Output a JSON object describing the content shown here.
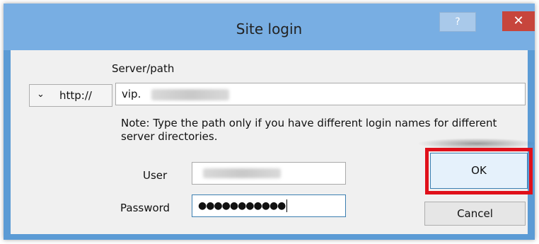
{
  "window": {
    "title": "Site login",
    "help_symbol": "?",
    "close_symbol": "✕"
  },
  "form": {
    "protocol_selected": "http://",
    "protocol_icon": "chevron-down-icon",
    "server_label": "Server/path",
    "server_value_prefix": "vip.",
    "note": "Note: Type the path only if you have different login names for different server directories.",
    "user_label": "User",
    "password_label": "Password",
    "password_mask": "●●●●●●●●●●●"
  },
  "buttons": {
    "ok": "OK",
    "cancel": "Cancel"
  },
  "colors": {
    "highlight": "#e0101a",
    "close": "#c7453c",
    "titlebar": "#78aee3"
  }
}
